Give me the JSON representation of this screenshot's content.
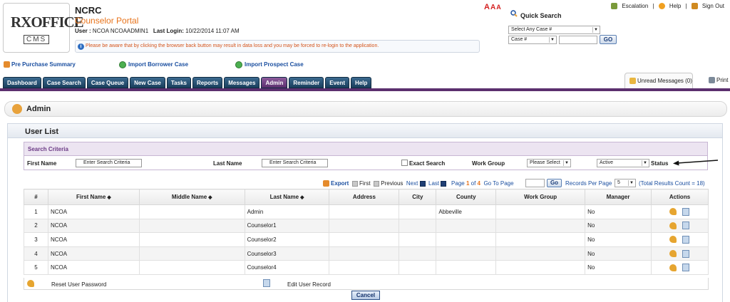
{
  "header": {
    "logo_line1": "RXOFFICE",
    "logo_line2": "CMS",
    "org": "NCRC",
    "portal": "Counselor Portal",
    "user_label": "User :",
    "user_value": "NCOA NCOAADMIN1",
    "last_login_label": "Last Login:",
    "last_login_value": "10/22/2014 11:07 AM",
    "notice": "Please be aware that by clicking the browser back button may result in data loss and you may be forced to re-login to the application.",
    "font_sizer": "A A A",
    "toplinks": {
      "escalation": "Escalation",
      "help": "Help",
      "signout": "Sign Out"
    }
  },
  "quick_search": {
    "title": "Quick Search",
    "case_select": "Select Any Case #",
    "field_select": "Case #",
    "go": "GO"
  },
  "shortcuts": {
    "pre_purchase": "Pre Purchase Summary",
    "import_borrower": "Import Borrower Case",
    "import_prospect": "Import Prospect Case"
  },
  "tabs": [
    "Dashboard",
    "Case Search",
    "Case Queue",
    "New Case",
    "Tasks",
    "Reports",
    "Messages",
    "Admin",
    "Reminder",
    "Event",
    "Help"
  ],
  "active_tab": "Admin",
  "unread": "Unread Messages (0)",
  "print": "Print",
  "page_title": "Admin",
  "panel_title": "User List",
  "criteria": {
    "title": "Search Criteria",
    "first_name_label": "First Name",
    "first_name_value": "Enter Search Criteria",
    "last_name_label": "Last Name",
    "last_name_value": "Enter Search Criteria",
    "exact_search": "Exact Search",
    "work_group_label": "Work Group",
    "work_group_value": "Please Select",
    "status_value": "Active",
    "status_label": "Status"
  },
  "pager": {
    "export": "Export",
    "first": "First",
    "previous": "Previous",
    "next": "Next",
    "last": "Last",
    "page_label": "Page",
    "page_current": "1",
    "of_label": "of",
    "page_total": "4",
    "goto_label": "Go To Page",
    "go": "Go",
    "records_label": "Records Per Page",
    "records_value": "5",
    "total": "(Total Results Count = 18)"
  },
  "table": {
    "columns": [
      "#",
      "First Name",
      "Middle Name",
      "Last Name",
      "Address",
      "City",
      "County",
      "Work Group",
      "Manager",
      "Actions"
    ],
    "rows": [
      {
        "num": "1",
        "first": "NCOA",
        "middle": "",
        "last": "Admin",
        "address": "",
        "city": "",
        "county": "Abbeville",
        "group": "",
        "manager": "No"
      },
      {
        "num": "2",
        "first": "NCOA",
        "middle": "",
        "last": "Counselor1",
        "address": "",
        "city": "",
        "county": "",
        "group": "",
        "manager": "No"
      },
      {
        "num": "3",
        "first": "NCOA",
        "middle": "",
        "last": "Counselor2",
        "address": "",
        "city": "",
        "county": "",
        "group": "",
        "manager": "No"
      },
      {
        "num": "4",
        "first": "NCOA",
        "middle": "",
        "last": "Counselor3",
        "address": "",
        "city": "",
        "county": "",
        "group": "",
        "manager": "No"
      },
      {
        "num": "5",
        "first": "NCOA",
        "middle": "",
        "last": "Counselor4",
        "address": "",
        "city": "",
        "county": "",
        "group": "",
        "manager": "No"
      }
    ]
  },
  "legend": {
    "reset": "Reset User Password",
    "edit": "Edit User Record"
  },
  "cancel": "Cancel"
}
